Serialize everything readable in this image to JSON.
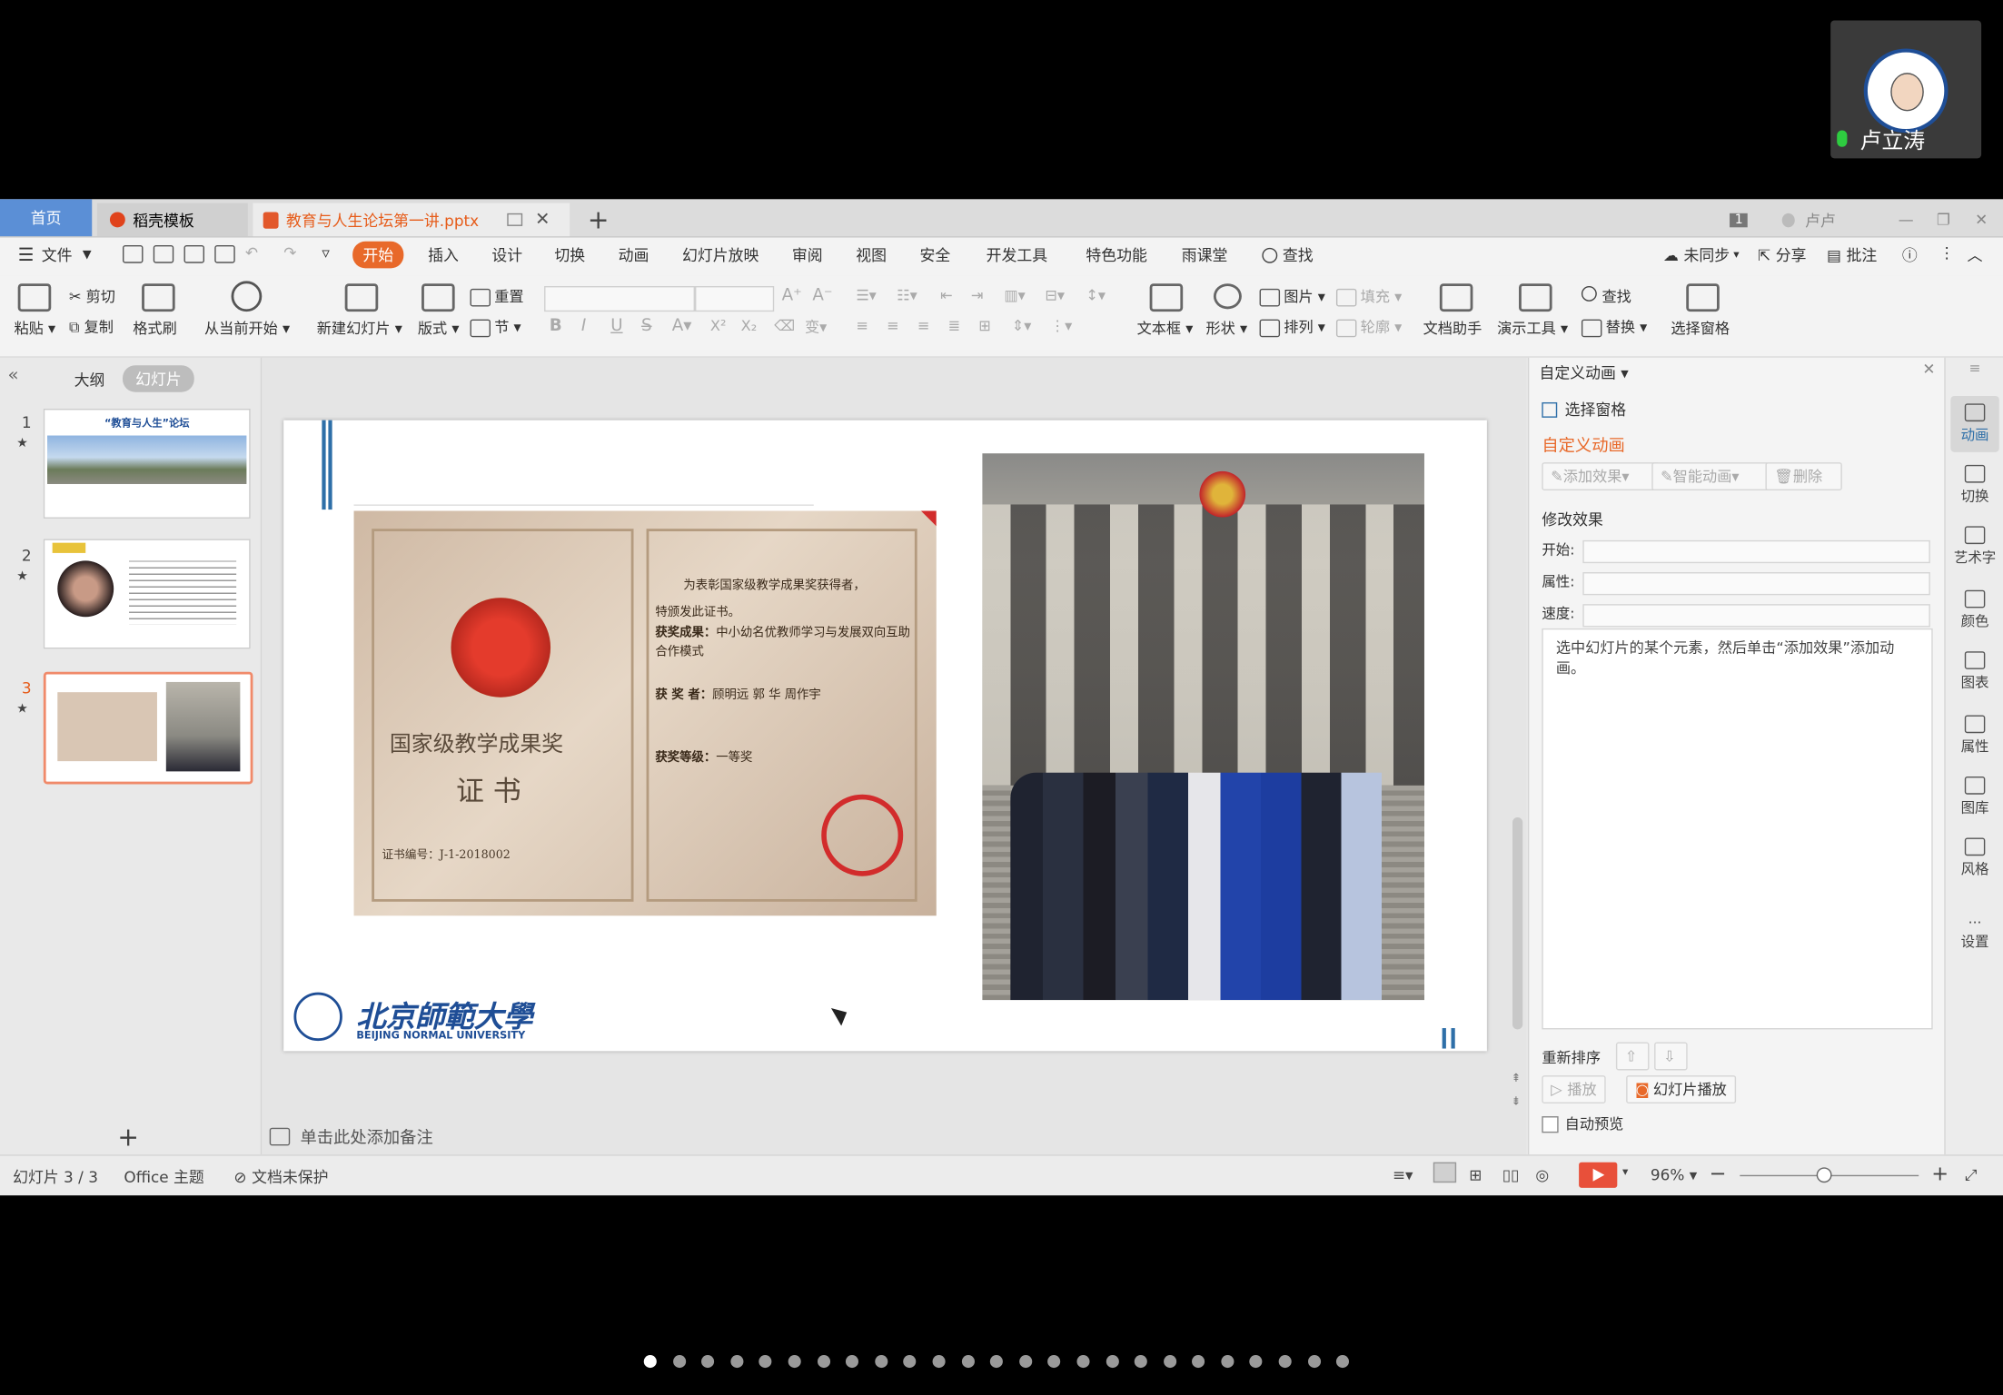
{
  "meeting": {
    "speaker_name": "卢立涛"
  },
  "tabs": {
    "home": "首页",
    "template": "稻壳模板",
    "file": "教育与人生论坛第一讲.pptx",
    "window_count": "1",
    "user": "卢卢"
  },
  "menu": {
    "file": "文件",
    "items": [
      "开始",
      "插入",
      "设计",
      "切换",
      "动画",
      "幻灯片放映",
      "审阅",
      "视图",
      "安全",
      "开发工具",
      "特色功能",
      "雨课堂"
    ],
    "search": "查找",
    "sync": "未同步",
    "share": "分享",
    "comment": "批注"
  },
  "ribbon": {
    "paste": "粘贴",
    "cut": "剪切",
    "copy": "复制",
    "format_painter": "格式刷",
    "from_current": "从当前开始",
    "new_slide": "新建幻灯片",
    "layout": "版式",
    "reset": "重置",
    "section": "节",
    "textbox": "文本框",
    "shape": "形状",
    "picture": "图片",
    "fill": "填充",
    "arrange": "排列",
    "outline": "轮廓",
    "doc_helper": "文档助手",
    "presentation_tools": "演示工具",
    "find": "查找",
    "replace": "替换",
    "select_pane": "选择窗格"
  },
  "left_pane": {
    "tab_outline": "大纲",
    "tab_slides": "幻灯片",
    "slides": [
      {
        "num": "1",
        "title": "“教育与人生”论坛"
      },
      {
        "num": "2",
        "title": ""
      },
      {
        "num": "3",
        "title": ""
      }
    ]
  },
  "slide": {
    "certificate": {
      "line1": "为表彰国家级教学成果奖获得者，",
      "line2": "特颁发此证书。",
      "result_label": "获奖成果：",
      "result_text": "中小幼名优教师学习与发展双向互助合作模式",
      "winners_label": "获 奖 者：",
      "winners_text": "顾明远 郭 华 周作宇",
      "level_label": "获奖等级：",
      "level_text": "一等奖",
      "title": "国家级教学成果奖",
      "subtitle": "证 书",
      "number": "证书编号：J-1-2018002"
    },
    "logo_cn": "北京師範大學",
    "logo_en": "BEIJING NORMAL UNIVERSITY"
  },
  "notes_placeholder": "单击此处添加备注",
  "animation_panel": {
    "header": "自定义动画",
    "select_pane": "选择窗格",
    "title": "自定义动画",
    "add_effect": "添加效果",
    "smart_anim": "智能动画",
    "delete": "删除",
    "modify": "修改效果",
    "start": "开始:",
    "property": "属性:",
    "speed": "速度:",
    "hint": "选中幻灯片的某个元素，然后单击“添加效果”添加动画。",
    "reorder": "重新排序",
    "play": "播放",
    "slideshow": "幻灯片播放",
    "auto_preview": "自动预览"
  },
  "sidebar": [
    "动画",
    "切换",
    "艺术字",
    "颜色",
    "图表",
    "属性",
    "图库",
    "风格",
    "设置"
  ],
  "status": {
    "slide_count": "幻灯片 3 / 3",
    "theme": "Office 主题",
    "protect": "文档未保护",
    "zoom": "96%"
  },
  "pagination": {
    "total": 25,
    "active": 0
  }
}
